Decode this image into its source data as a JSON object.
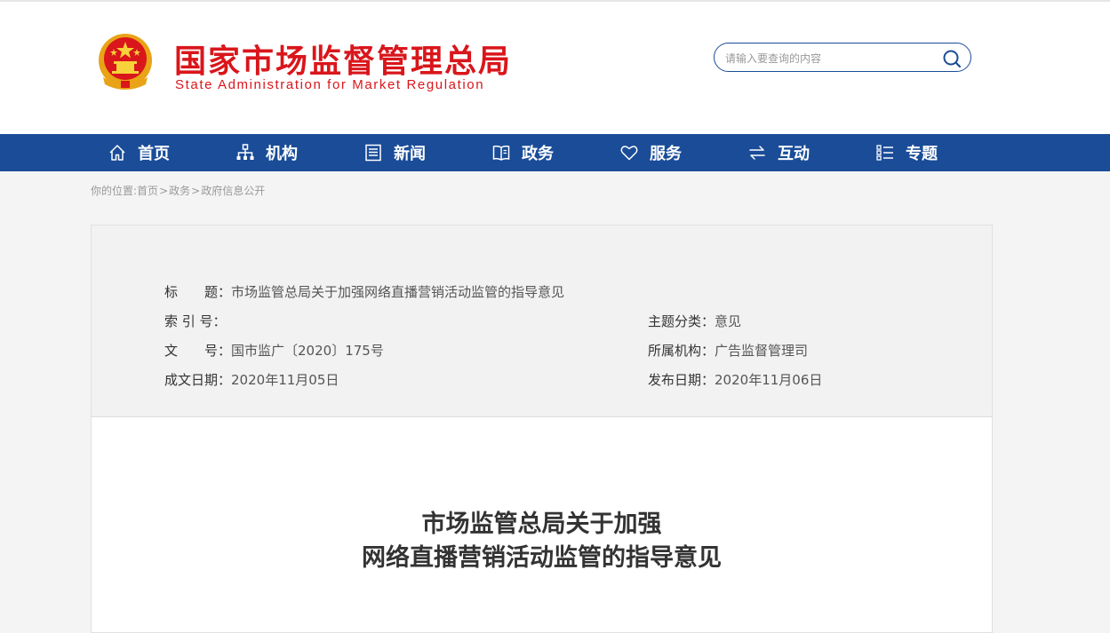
{
  "header": {
    "site_name_cn": "国家市场监督管理总局",
    "site_name_en": "State Administration for Market Regulation",
    "search_placeholder": "请输入要查询的内容",
    "emblem_icon": "national-emblem-icon",
    "search_icon": "search-icon"
  },
  "nav": {
    "items": [
      {
        "label": "首页",
        "icon": "home-icon"
      },
      {
        "label": "机构",
        "icon": "org-chart-icon"
      },
      {
        "label": "新闻",
        "icon": "news-icon"
      },
      {
        "label": "政务",
        "icon": "book-icon"
      },
      {
        "label": "服务",
        "icon": "heart-icon"
      },
      {
        "label": "互动",
        "icon": "swap-icon"
      },
      {
        "label": "专题",
        "icon": "list-icon"
      }
    ]
  },
  "breadcrumb": {
    "prefix": "你的位置:",
    "items": [
      "首页",
      "政务",
      "政府信息公开"
    ],
    "sep": ">"
  },
  "meta": {
    "title_label": "标　　题：",
    "title_value": "市场监管总局关于加强网络直播营销活动监管的指导意见",
    "index_label": "索 引 号：",
    "index_value": "",
    "category_label": "主题分类：",
    "category_value": "意见",
    "docno_label": "文　　号：",
    "docno_value": "国市监广〔2020〕175号",
    "org_label": "所属机构：",
    "org_value": "广告监督管理司",
    "created_label": "成文日期：",
    "created_value": "2020年11月05日",
    "published_label": "发布日期：",
    "published_value": "2020年11月06日"
  },
  "document": {
    "title_line1": "市场监管总局关于加强",
    "title_line2": "网络直播营销活动监管的指导意见"
  },
  "colors": {
    "brand_red": "#d9161b",
    "nav_blue": "#1a4c98"
  }
}
